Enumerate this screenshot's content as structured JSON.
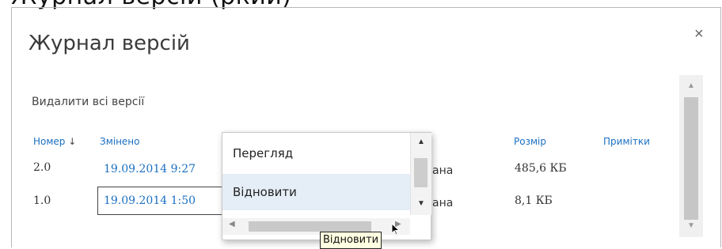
{
  "page": {
    "partial_heading": "Журнал версій (ркий)"
  },
  "dialog": {
    "title": "Журнал версій",
    "close_symbol": "×",
    "delete_all_link": "Видалити всі версії"
  },
  "table": {
    "headers": {
      "number": "Номер",
      "sort_indicator": "↓",
      "modified": "Змінено",
      "size": "Розмір",
      "comments": "Примітки"
    },
    "rows": [
      {
        "number": "2.0",
        "modified": "19.09.2014 9:27",
        "partial_author": "ана",
        "size": "485,6 КБ"
      },
      {
        "number": "1.0",
        "modified": "19.09.2014 1:50",
        "partial_author": "ана",
        "size": "8,1 КБ"
      }
    ]
  },
  "context_menu": {
    "items": [
      "Перегляд",
      "Відновити"
    ],
    "selected_index": 1
  },
  "tooltip": {
    "text": "Відновити"
  },
  "icons": {
    "close": "close-icon",
    "sort": "sort-down-arrow-icon",
    "dropdown": "dropdown-arrow-icon",
    "scroll_up": "scroll-up-arrow-icon",
    "scroll_down": "scroll-down-arrow-icon",
    "scroll_left": "scroll-left-arrow-icon",
    "scroll_right": "scroll-right-arrow-icon",
    "pointer": "mouse-pointer-icon"
  },
  "colors": {
    "link": "#1b6fc2",
    "selected_bg": "#e5eef7",
    "tooltip_bg": "#ffffe1"
  }
}
